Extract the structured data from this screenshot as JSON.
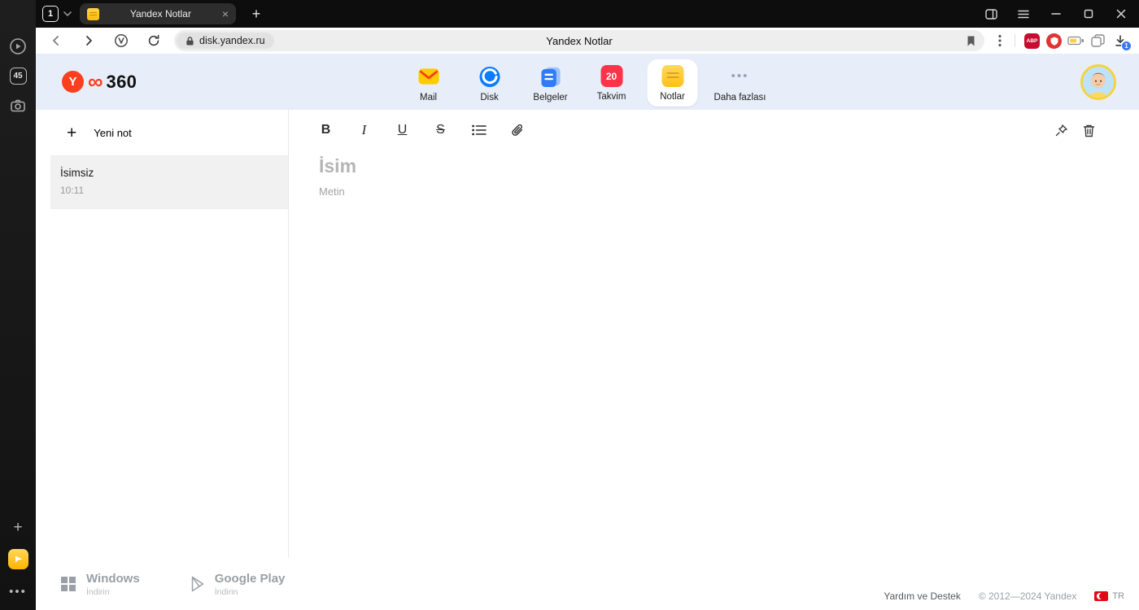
{
  "browser": {
    "tab_group_count": "1",
    "tab_title": "Yandex Notlar",
    "address": "disk.yandex.ru",
    "page_title": "Yandex Notlar",
    "download_badge": "1",
    "sidebar_tabs_badge": "45",
    "abp_label": "ABP"
  },
  "service_header": {
    "logo_text": "360",
    "logo_loop": "∞",
    "nav": [
      {
        "label": "Mail"
      },
      {
        "label": "Disk"
      },
      {
        "label": "Belgeler"
      },
      {
        "label": "Takvim",
        "badge": "20"
      },
      {
        "label": "Notlar"
      },
      {
        "label": "Daha fazlası"
      }
    ]
  },
  "notes_panel": {
    "new_note_label": "Yeni not",
    "notes": [
      {
        "title": "İsimsiz",
        "time": "10:11"
      }
    ]
  },
  "editor": {
    "toolbar": {
      "bold": "B",
      "italic": "I",
      "underline": "U",
      "strikethrough": "S"
    },
    "title_placeholder": "İsim",
    "body_placeholder": "Metin"
  },
  "footer": {
    "apps": [
      {
        "name": "Windows",
        "action": "İndirin"
      },
      {
        "name": "Google Play",
        "action": "İndirin"
      }
    ],
    "help": "Yardım ve Destek",
    "copyright": "© 2012—2024 Yandex",
    "language": "TR"
  },
  "colors": {
    "accent_red": "#fc3f1d",
    "accent_yellow": "#ffcc00",
    "accent_blue": "#0b7bff",
    "header_bg": "#e8eef9"
  }
}
